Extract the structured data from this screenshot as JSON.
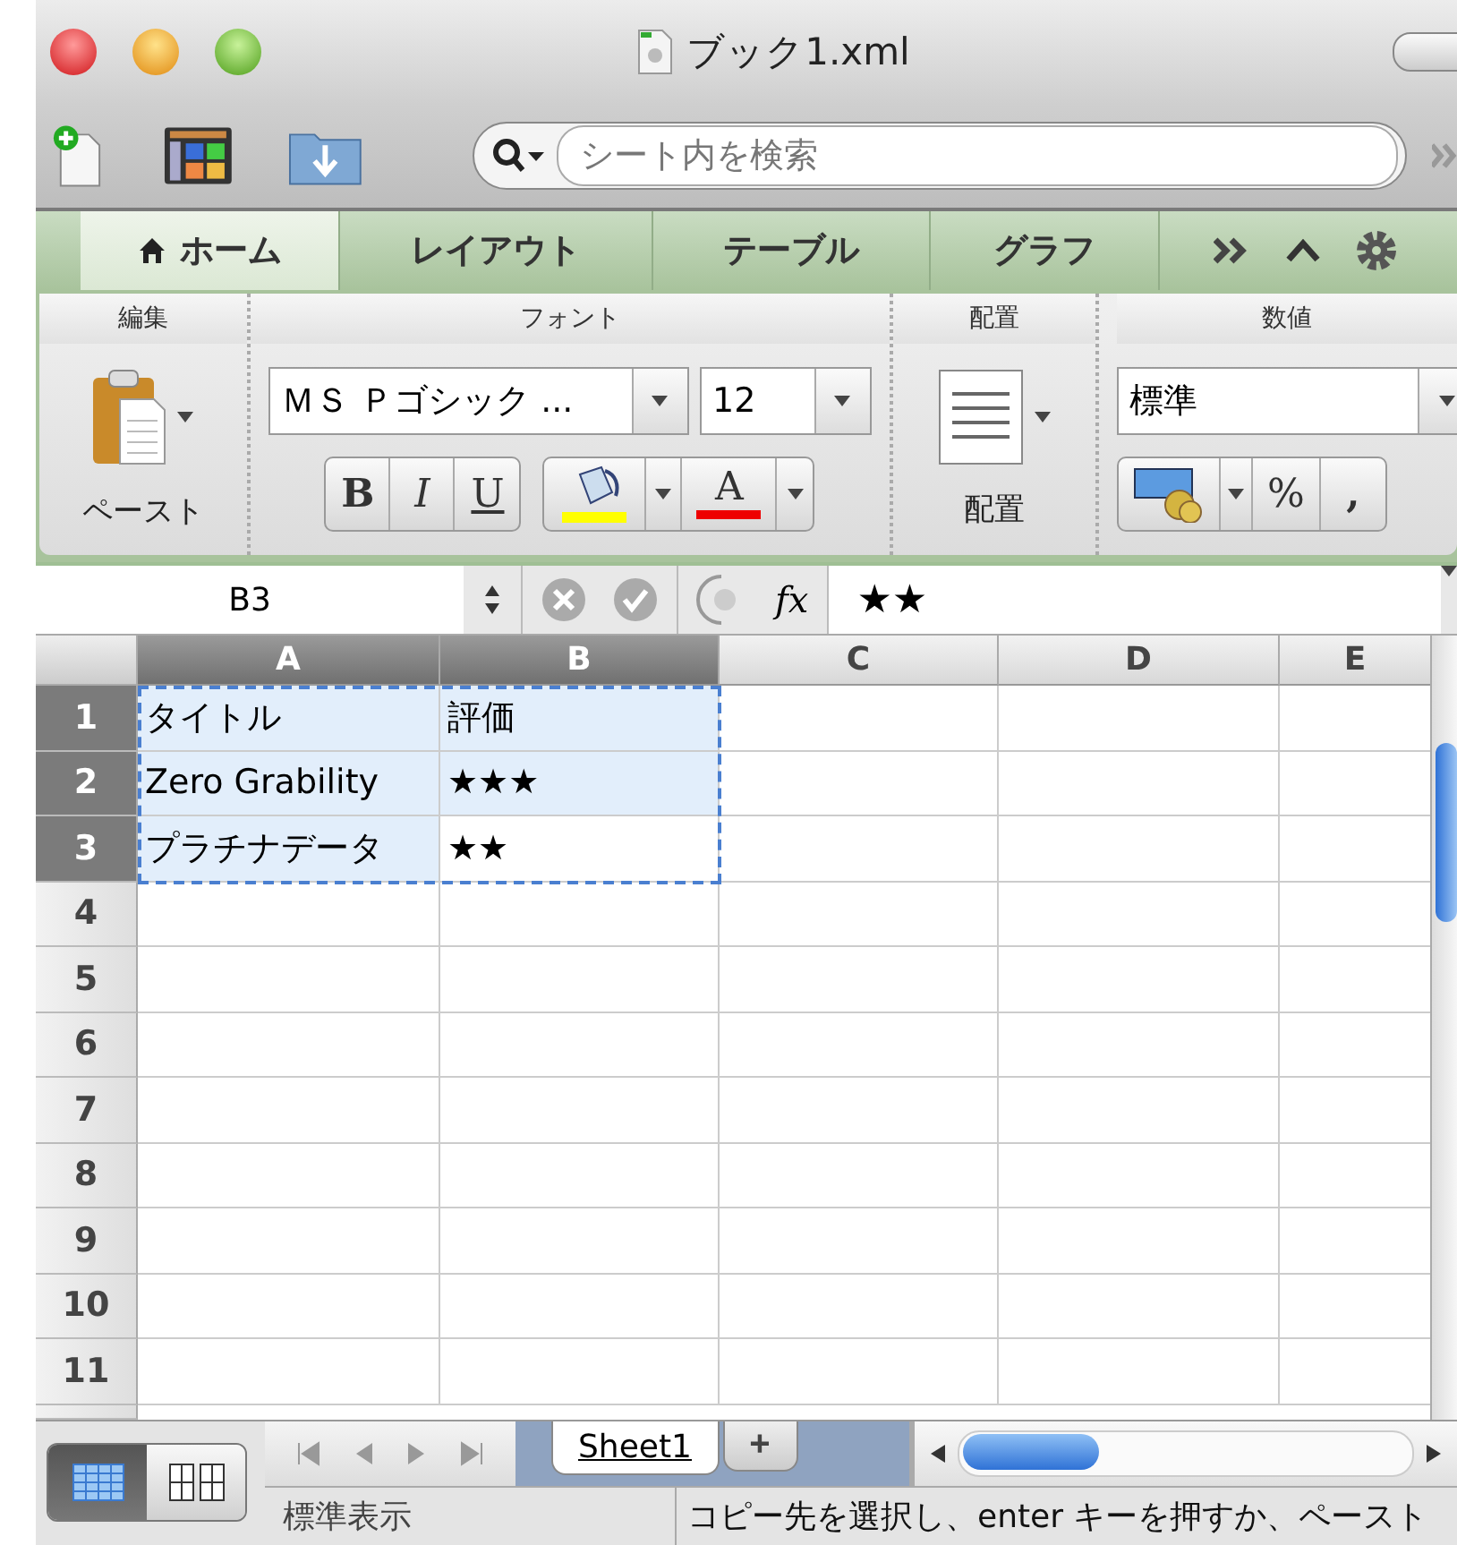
{
  "window": {
    "title": "ブック1.xml"
  },
  "toolbar": {
    "search": {
      "placeholder": "シート内を検索"
    }
  },
  "ribbon_tabs": [
    {
      "label": "ホーム",
      "selected": true
    },
    {
      "label": "レイアウト",
      "selected": false
    },
    {
      "label": "テーブル",
      "selected": false
    },
    {
      "label": "グラフ",
      "selected": false
    }
  ],
  "ribbon_groups": {
    "edit": {
      "title": "編集",
      "paste_label": "ペースト"
    },
    "font": {
      "title": "フォント",
      "font_name": "ＭＳ Ｐゴシック ...",
      "font_size": "12",
      "bold": "B",
      "italic": "I",
      "underline": "U",
      "font_color": "A"
    },
    "alignment": {
      "title": "配置",
      "label": "配置"
    },
    "number": {
      "title": "数値",
      "format": "標準",
      "percent": "%",
      "comma": ","
    }
  },
  "formula_bar": {
    "name_box": "B3",
    "fx": "fx",
    "formula": "★★"
  },
  "sheet": {
    "columns": [
      {
        "label": "A",
        "selected": true
      },
      {
        "label": "B",
        "selected": true
      },
      {
        "label": "C",
        "selected": false
      },
      {
        "label": "D",
        "selected": false
      },
      {
        "label": "E",
        "selected": false
      }
    ],
    "rows": [
      {
        "label": "1",
        "selected": true,
        "cells": [
          {
            "text": "タイトル",
            "active": false
          },
          {
            "text": "評価",
            "active": false
          }
        ]
      },
      {
        "label": "2",
        "selected": true,
        "cells": [
          {
            "text": "Zero Grability",
            "active": false
          },
          {
            "text": "★★★",
            "active": false
          }
        ]
      },
      {
        "label": "3",
        "selected": true,
        "cells": [
          {
            "text": "プラチナデータ",
            "active": false
          },
          {
            "text": "★★",
            "active": true
          }
        ]
      },
      {
        "label": "4",
        "selected": false
      },
      {
        "label": "5",
        "selected": false
      },
      {
        "label": "6",
        "selected": false
      },
      {
        "label": "7",
        "selected": false
      },
      {
        "label": "8",
        "selected": false
      },
      {
        "label": "9",
        "selected": false
      },
      {
        "label": "10",
        "selected": false
      },
      {
        "label": "11",
        "selected": false
      }
    ]
  },
  "sheet_tabs": [
    {
      "label": "Sheet1",
      "selected": true
    }
  ],
  "add_sheet": "+",
  "status_bar": {
    "view": "標準表示",
    "message": "コピー先を選択し、enter キーを押すか、ペースト"
  }
}
